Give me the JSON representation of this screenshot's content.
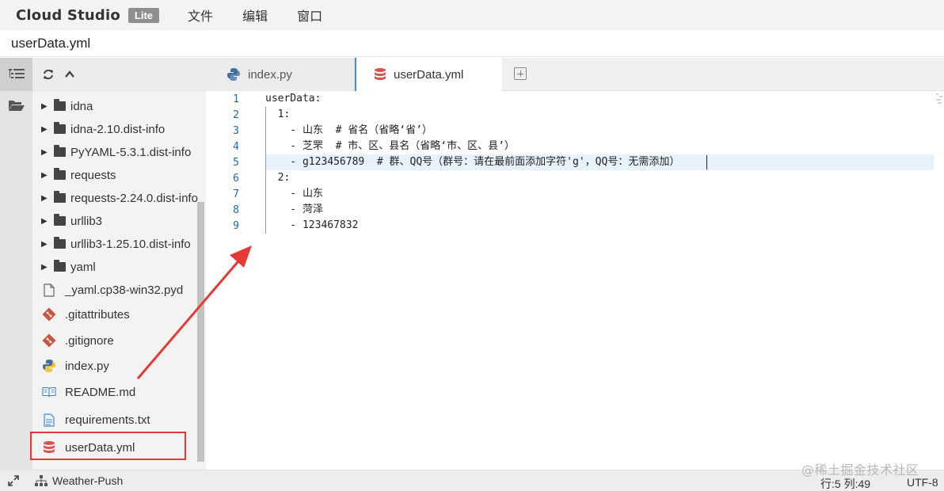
{
  "app": {
    "brand": "Cloud Studio",
    "edition_badge": "Lite",
    "menu": [
      "文件",
      "编辑",
      "窗口"
    ]
  },
  "file_title": "userData.yml",
  "explorer": {
    "items": [
      {
        "type": "folder",
        "label": "idna"
      },
      {
        "type": "folder",
        "label": "idna-2.10.dist-info"
      },
      {
        "type": "folder",
        "label": "PyYAML-5.3.1.dist-info"
      },
      {
        "type": "folder",
        "label": "requests"
      },
      {
        "type": "folder",
        "label": "requests-2.24.0.dist-info"
      },
      {
        "type": "folder",
        "label": "urllib3"
      },
      {
        "type": "folder",
        "label": "urllib3-1.25.10.dist-info"
      },
      {
        "type": "folder",
        "label": "yaml"
      },
      {
        "type": "file",
        "icon": "file-icon",
        "label": "_yaml.cp38-win32.pyd"
      },
      {
        "type": "file",
        "icon": "git-icon",
        "label": ".gitattributes"
      },
      {
        "type": "file",
        "icon": "git-icon",
        "label": ".gitignore"
      },
      {
        "type": "file",
        "icon": "python-icon",
        "label": "index.py"
      },
      {
        "type": "file",
        "icon": "book-icon",
        "label": "README.md"
      },
      {
        "type": "file",
        "icon": "text-file-icon",
        "label": "requirements.txt"
      },
      {
        "type": "file",
        "icon": "database-icon",
        "label": "userData.yml",
        "selected": true
      }
    ]
  },
  "tabs": [
    {
      "label": "index.py",
      "icon": "python-icon",
      "active": false
    },
    {
      "label": "userData.yml",
      "icon": "database-icon",
      "active": true
    }
  ],
  "editor": {
    "lines": [
      {
        "n": "1",
        "text": "userData:"
      },
      {
        "n": "2",
        "text": "  1:"
      },
      {
        "n": "3",
        "text": "    - 山东  # 省名（省略‘省’）"
      },
      {
        "n": "4",
        "text": "    - 芝罘  # 市、区、县名（省略‘市、区、县’）"
      },
      {
        "n": "5",
        "text": "    - g123456789  # 群、QQ号（群号：请在最前面添加字符'g'，QQ号：无需添加）"
      },
      {
        "n": "6",
        "text": "  2:"
      },
      {
        "n": "7",
        "text": "    - 山东"
      },
      {
        "n": "8",
        "text": "    - 菏泽"
      },
      {
        "n": "9",
        "text": "    - 123467832"
      }
    ],
    "active_line": 5
  },
  "status": {
    "project": "Weather-Push",
    "position": "行:5 列:49",
    "encoding": "UTF-8"
  },
  "watermark": "@稀土掘金技术社区",
  "colors": {
    "annotation_red": "#e53935",
    "line_number_blue": "#1a6aa8",
    "active_tab_accent": "#4a90d9",
    "database_icon_red": "#d9534f"
  }
}
